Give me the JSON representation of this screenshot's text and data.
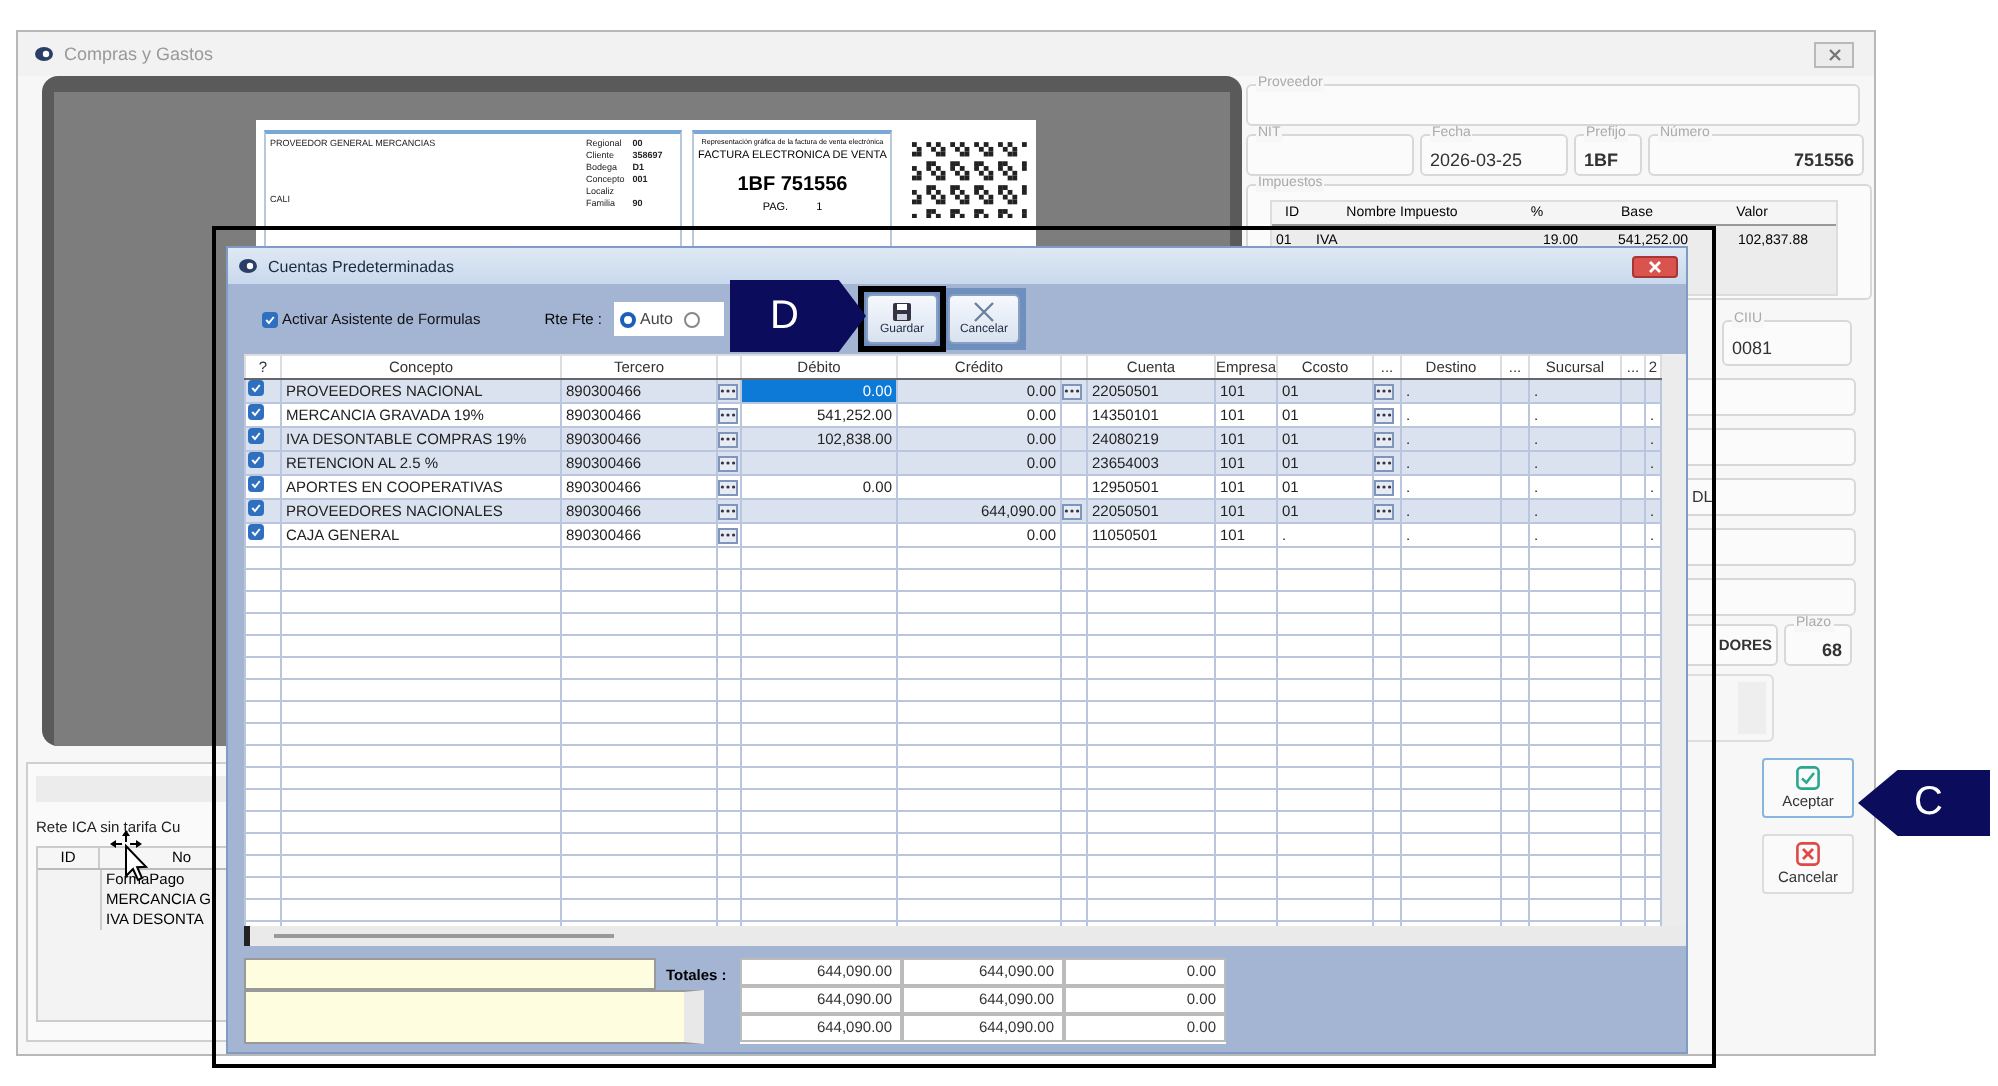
{
  "main_window": {
    "title": "Compras y Gastos",
    "preview": {
      "supplier": "PROVEEDOR GENERAL MERCANCIAS",
      "city": "CALI",
      "details": [
        {
          "label": "Regional",
          "value": "00"
        },
        {
          "label": "Cliente",
          "value": "358697"
        },
        {
          "label": "Bodega",
          "value": "D1"
        },
        {
          "label": "Concepto",
          "value": "001"
        },
        {
          "label": "Localiz"
        },
        {
          "label": "Familia",
          "value": "90"
        }
      ],
      "caption": "Representación gráfica de la factura de venta electrónica",
      "doc_title": "FACTURA ELECTRONICA DE VENTA",
      "doc_number": "1BF 751556",
      "page_label": "PAG.",
      "page_number": "1"
    },
    "lower_panel": {
      "title": "Rete ICA sin tarifa Cu",
      "columns": [
        "ID",
        "No"
      ],
      "rows": [
        "FormaPago",
        "MERCANCIA G",
        "IVA DESONTA"
      ]
    },
    "proveedor": {
      "legend": "Proveedor"
    },
    "header_fields": [
      {
        "legend": "NIT"
      },
      {
        "legend": "Fecha",
        "value": "2026-03-25",
        "bold": false
      },
      {
        "legend": "Prefijo",
        "value": "1BF",
        "bold": true
      },
      {
        "legend": "Número",
        "value": "751556",
        "bold": true
      }
    ],
    "impuestos": {
      "legend": "Impuestos",
      "columns": [
        "ID",
        "Nombre Impuesto",
        "%",
        "Base",
        "Valor"
      ],
      "rows": [
        [
          "01",
          "IVA",
          "19.00",
          "541,252.00",
          "102,837.88"
        ]
      ]
    },
    "ciiu": {
      "legend": "CIIU",
      "value": "0081"
    },
    "side_fields": [
      {
        "kind": "empty"
      },
      {
        "kind": "empty"
      },
      {
        "kind": "text",
        "value": "DL"
      },
      {
        "kind": "empty"
      },
      {
        "kind": "empty"
      }
    ],
    "term_row": {
      "value": "DORES",
      "plazo": {
        "legend": "Plazo",
        "value": "68"
      }
    },
    "buttons": [
      {
        "label": "Aceptar",
        "kind": "accept",
        "focused": true
      },
      {
        "label": "Cancelar",
        "kind": "cancel",
        "focused": false
      }
    ]
  },
  "dialog": {
    "title": "Cuentas Predeterminadas",
    "highlighted": true,
    "formula_assistant": {
      "label": "Activar Asistente de Formulas",
      "checked": true
    },
    "rte_fte": {
      "label": "Rte Fte :",
      "options": [
        {
          "label": "Auto",
          "selected": true
        },
        {
          "selected": false
        }
      ]
    },
    "buttons": [
      {
        "label": "Guardar",
        "kind": "save",
        "highlighted": true
      },
      {
        "label": "Cancelar",
        "kind": "cancel",
        "highlighted": false
      }
    ],
    "grid": {
      "columns": [
        {
          "kind": "label",
          "label": "?"
        },
        {
          "kind": "label",
          "label": "Concepto"
        },
        {
          "kind": "label",
          "label": "Tercero"
        },
        {
          "kind": "blank"
        },
        {
          "kind": "label",
          "label": "Débito"
        },
        {
          "kind": "label",
          "label": "Crédito"
        },
        {
          "kind": "blank"
        },
        {
          "kind": "label",
          "label": "Cuenta"
        },
        {
          "kind": "label",
          "label": "Empresa"
        },
        {
          "kind": "label",
          "label": "Ccosto"
        },
        {
          "kind": "label",
          "label": "..."
        },
        {
          "kind": "label",
          "label": "Destino"
        },
        {
          "kind": "label",
          "label": "..."
        },
        {
          "kind": "label",
          "label": "Sucursal"
        },
        {
          "kind": "label",
          "label": "..."
        },
        {
          "kind": "label",
          "label": "2"
        }
      ],
      "rows": [
        {
          "checked": true,
          "highlighted": true,
          "concepto": "PROVEEDORES NACIONAL",
          "tercero": "890300466",
          "debito": "0.00",
          "debito_selected": true,
          "credito": "0.00",
          "credito_button": true,
          "cuenta": "22050501",
          "empresa": "101",
          "ccosto": "01",
          "ccosto_button": true,
          "destino": ".",
          "sucursal": "."
        },
        {
          "checked": true,
          "highlighted": false,
          "concepto": "MERCANCIA GRAVADA 19%",
          "tercero": "890300466",
          "debito": "541,252.00",
          "debito_selected": false,
          "credito": "0.00",
          "credito_button": false,
          "cuenta": "14350101",
          "empresa": "101",
          "ccosto": "01",
          "ccosto_button": true,
          "destino": ".",
          "sucursal": ".",
          "column_16": "."
        },
        {
          "checked": true,
          "highlighted": true,
          "concepto": "IVA DESONTABLE COMPRAS 19%",
          "tercero": "890300466",
          "debito": "102,838.00",
          "debito_selected": false,
          "credito": "0.00",
          "credito_button": false,
          "cuenta": "24080219",
          "empresa": "101",
          "ccosto": "01",
          "ccosto_button": true,
          "destino": ".",
          "sucursal": ".",
          "column_16": "."
        },
        {
          "checked": true,
          "highlighted": true,
          "concepto": "RETENCION AL  2.5 %",
          "tercero": "890300466",
          "debito_selected": false,
          "credito": "0.00",
          "credito_button": false,
          "cuenta": "23654003",
          "empresa": "101",
          "ccosto": "01",
          "ccosto_button": true,
          "destino": ".",
          "sucursal": ".",
          "column_16": "."
        },
        {
          "checked": true,
          "highlighted": false,
          "concepto": "APORTES EN COOPERATIVAS",
          "tercero": "890300466",
          "debito": "0.00",
          "debito_selected": false,
          "credito_button": false,
          "cuenta": "12950501",
          "empresa": "101",
          "ccosto": "01",
          "ccosto_button": true,
          "destino": ".",
          "sucursal": ".",
          "column_16": "."
        },
        {
          "checked": true,
          "highlighted": true,
          "concepto": "PROVEEDORES NACIONALES",
          "tercero": "890300466",
          "debito_selected": false,
          "credito": "644,090.00",
          "credito_button": true,
          "cuenta": "22050501",
          "empresa": "101",
          "ccosto": "01",
          "ccosto_button": true,
          "destino": ".",
          "sucursal": ".",
          "column_16": "."
        },
        {
          "checked": true,
          "highlighted": false,
          "concepto": "CAJA GENERAL",
          "tercero": "890300466",
          "debito_selected": false,
          "credito": "0.00",
          "credito_button": false,
          "cuenta": "11050501",
          "empresa": "101",
          "ccosto": ".",
          "ccosto_button": false,
          "destino": ".",
          "sucursal": ".",
          "column_16": "."
        }
      ]
    },
    "totals": {
      "label": "Totales :",
      "rows": [
        [
          "644,090.00",
          "644,090.00",
          "0.00"
        ],
        [
          "644,090.00",
          "644,090.00",
          "0.00"
        ],
        [
          "644,090.00",
          "644,090.00",
          "0.00"
        ]
      ]
    }
  },
  "callouts": [
    {
      "letter": "D",
      "kind": "arrow-right"
    },
    {
      "letter": "C",
      "kind": "arrow-left"
    }
  ]
}
